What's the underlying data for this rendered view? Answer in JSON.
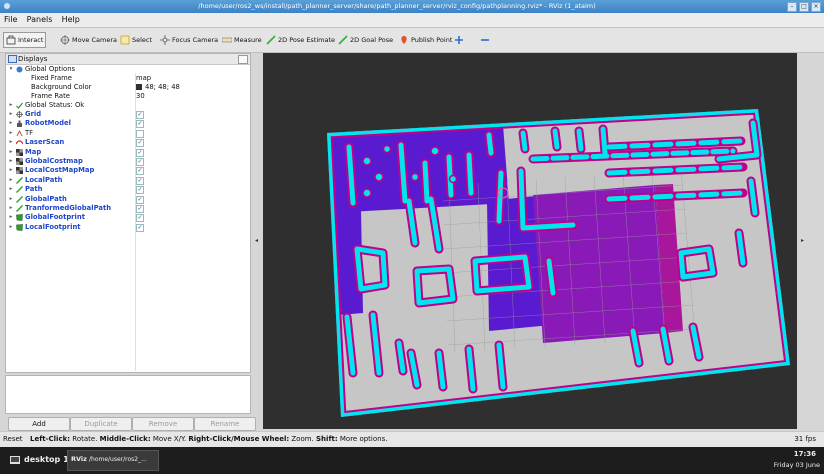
{
  "window": {
    "title": "/home/user/ros2_ws/install/path_planner_server/share/path_planner_server/rviz_config/pathplanning.rviz* - RViz (1_ataim)"
  },
  "menu": [
    "File",
    "Panels",
    "Help"
  ],
  "toolbar": [
    {
      "label": "Interact",
      "icon": "interact-icon",
      "active": true
    },
    {
      "label": "Move Camera",
      "icon": "move-camera-icon"
    },
    {
      "label": "Select",
      "icon": "select-icon"
    },
    {
      "label": "Focus Camera",
      "icon": "focus-camera-icon"
    },
    {
      "label": "Measure",
      "icon": "measure-icon"
    },
    {
      "label": "2D Pose Estimate",
      "icon": "pose-estimate-icon"
    },
    {
      "label": "2D Goal Pose",
      "icon": "goal-pose-icon"
    },
    {
      "label": "Publish Point",
      "icon": "publish-point-icon"
    },
    {
      "label": "",
      "icon": "add-tool-icon"
    },
    {
      "label": "",
      "icon": "remove-tool-icon"
    }
  ],
  "displays": {
    "title": "Displays",
    "global_options": {
      "label": "Global Options",
      "fixed_frame": {
        "name": "Fixed Frame",
        "value": "map"
      },
      "background_color": {
        "name": "Background Color",
        "value": "48; 48; 48",
        "swatch": "#303030"
      },
      "frame_rate": {
        "name": "Frame Rate",
        "value": "30"
      }
    },
    "global_status": "Global Status: Ok",
    "items": [
      {
        "name": "Grid",
        "checked": true,
        "icon": "grid-icon"
      },
      {
        "name": "RobotModel",
        "checked": true,
        "icon": "robot-model-icon"
      },
      {
        "name": "TF",
        "checked": false,
        "icon": "tf-icon"
      },
      {
        "name": "LaserScan",
        "checked": true,
        "icon": "laser-scan-icon"
      },
      {
        "name": "Map",
        "checked": true,
        "icon": "map-icon"
      },
      {
        "name": "GlobalCostmap",
        "checked": true,
        "icon": "map-icon"
      },
      {
        "name": "LocalCostMapMap",
        "checked": true,
        "icon": "map-icon"
      },
      {
        "name": "LocalPath",
        "checked": true,
        "icon": "path-icon"
      },
      {
        "name": "Path",
        "checked": true,
        "icon": "path-icon"
      },
      {
        "name": "GlobalPath",
        "checked": true,
        "icon": "path-icon"
      },
      {
        "name": "TranformedGlobalPath",
        "checked": true,
        "icon": "path-icon"
      },
      {
        "name": "GlobalFootprint",
        "checked": true,
        "icon": "footprint-icon"
      },
      {
        "name": "LocalFootprint",
        "checked": true,
        "icon": "footprint-icon"
      }
    ],
    "buttons": {
      "add": "Add",
      "duplicate": "Duplicate",
      "remove": "Remove",
      "rename": "Rename"
    }
  },
  "status": {
    "reset": "Reset",
    "hint_parts": [
      {
        "text": "Left-Click:",
        "bold": true
      },
      {
        "text": " Rotate. ",
        "bold": false
      },
      {
        "text": "Middle-Click:",
        "bold": true
      },
      {
        "text": " Move X/Y. ",
        "bold": false
      },
      {
        "text": "Right-Click/Mouse Wheel:",
        "bold": true
      },
      {
        "text": " Zoom. ",
        "bold": false
      },
      {
        "text": "Shift:",
        "bold": true
      },
      {
        "text": " More options.",
        "bold": false
      }
    ],
    "fps": "31 fps"
  },
  "taskbar": {
    "desktop": "desktop 1",
    "task": "/home/user/ros2_...",
    "task_prefix": "RViz",
    "time": "17:36",
    "date": "Friday 03 June"
  },
  "colors": {
    "costmap_inflation": "#00e5ee",
    "costmap_lethal": "#c0008a",
    "free_space": "#c7c7c7",
    "costmap_blue": "#5a1ad0",
    "viewport_bg": "#303030"
  }
}
